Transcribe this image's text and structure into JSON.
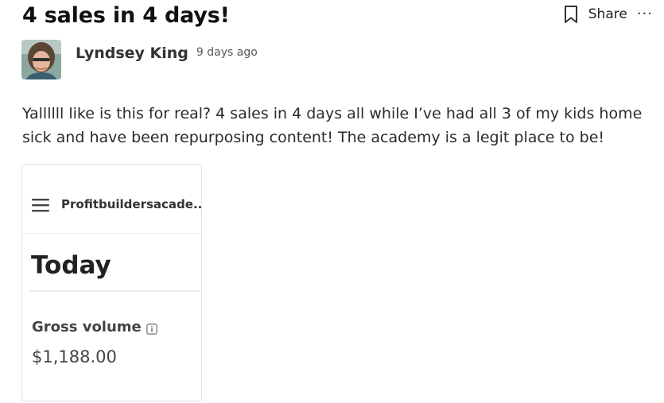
{
  "post": {
    "title": "4 sales in 4 days!",
    "share_label": "Share",
    "more_label": "···",
    "author_name": "Lyndsey King",
    "time_ago": "9 days ago",
    "body": "Yallllll like is this for real? 4 sales in 4 days all while I’ve had all 3 of my kids home sick and have been repurposing content! The academy is a legit place to be!"
  },
  "attachment": {
    "site_name": "Profitbuildersacade...",
    "heading": "Today",
    "metric_label": "Gross volume",
    "metric_value": "$1,188.00"
  },
  "icons": {
    "bookmark": "bookmark-icon",
    "more": "more-horizontal-icon",
    "menu": "hamburger-icon",
    "info": "info-icon"
  }
}
